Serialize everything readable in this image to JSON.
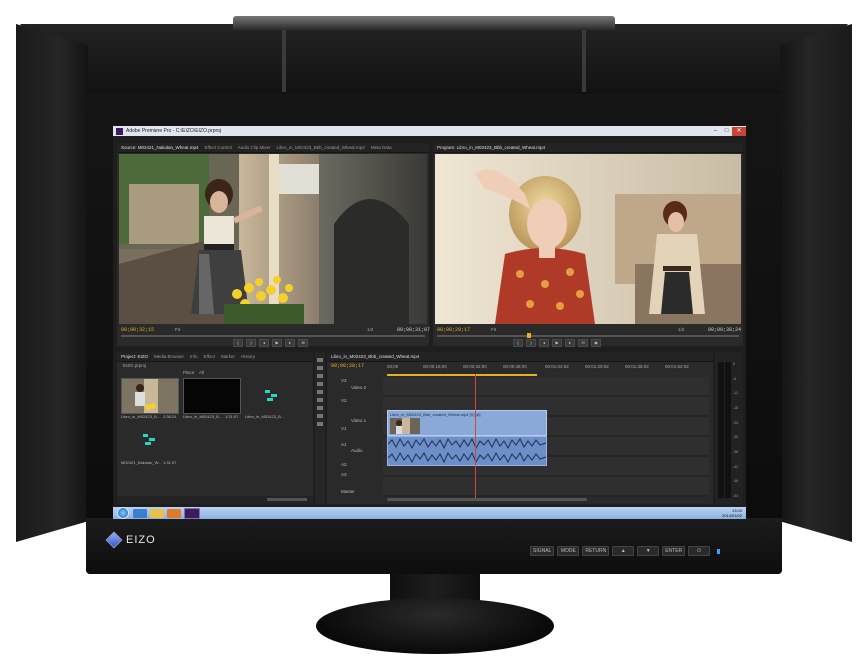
{
  "device": {
    "brand": "EIZO",
    "controls": [
      "SIGNAL",
      "MODE",
      "RETURN",
      "▲",
      "▼",
      "ENTER",
      "⏻"
    ]
  },
  "window": {
    "title": "Adobe Premiere Pro - C:\\EIZO\\EIZO.prproj",
    "buttons": [
      "–",
      "□",
      "✕"
    ]
  },
  "source_panel": {
    "tabs": [
      "Source: M02421_Nakulan_Wheat.mp4",
      "Effect Control",
      "Audio Clip Mixer",
      "Libro_in_M02423_Bbb_created_Wheat.mp4",
      "Meta Data"
    ],
    "timecode_in": "00;00;32;15",
    "fit": "Fit",
    "timecode_out": "00;00;31;07",
    "fraction": "1/2"
  },
  "program_panel": {
    "tabs": [
      "Program: Libro_in_M02423_Bbb_created_Wheat.mp4"
    ],
    "timecode_in": "00;00;20;17",
    "fit": "Fit",
    "timecode_out": "00;00;38;24",
    "fraction": "1/2"
  },
  "project_panel": {
    "tabs": [
      "Project: EIZO",
      "Media Browser",
      "Info",
      "Effect",
      "Marker",
      "History"
    ],
    "file": "EIZO.prproj",
    "place_label": "Place",
    "place_value": "All",
    "items": [
      {
        "label": "Libro_in_M02423_B...",
        "duration": "2:38:24"
      },
      {
        "label": "Libro_in_M02423_B...",
        "duration": "1:21:07"
      },
      {
        "label": "Libro_in_M02423_B...",
        "duration": ""
      },
      {
        "label": "M02421_Nakulan_W...",
        "duration": "1:31:07"
      }
    ]
  },
  "timeline": {
    "tab": "Libro_in_M02423_Bbb_created_Wheat.mp4",
    "timecode": "00;00;20;17",
    "ruler": [
      "00;00",
      "00;00;16;00",
      "00;00;32;00",
      "00;00;48;00",
      "00;01;04;02",
      "00;01;20;02",
      "00;01;36;02",
      "00;01;52;02"
    ],
    "tracks": [
      "V3",
      "Video 2",
      "V2",
      "Video 1",
      "V1",
      "A1",
      "Audio",
      "A2",
      "A3",
      "Master"
    ],
    "clip_label": "Libro_in_M02423_Bbb_created_Wheat.mp4 [V] [A]"
  },
  "meter_scale": [
    "0",
    "-6",
    "-12",
    "-18",
    "-24",
    "-30",
    "-36",
    "-42",
    "-48",
    "-54"
  ],
  "taskbar": {
    "time": "13:00",
    "date": "2014/01/02"
  }
}
